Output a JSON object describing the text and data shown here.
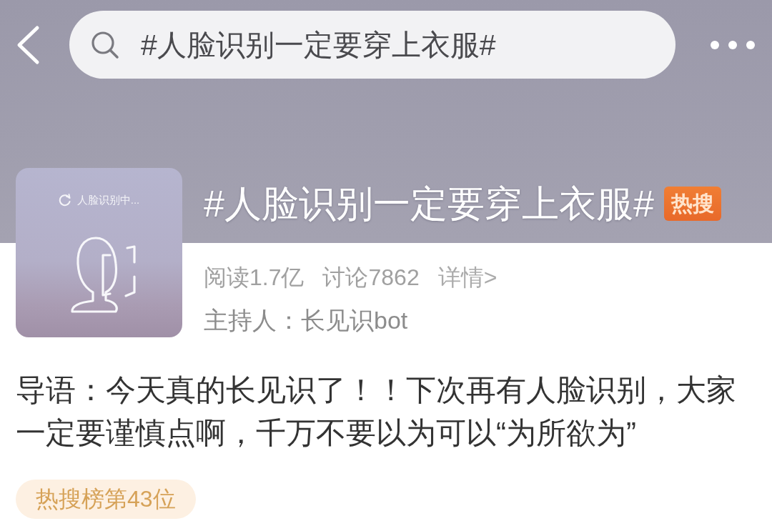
{
  "top_bar": {
    "search": {
      "value": "#人脸识别一定要穿上衣服#"
    }
  },
  "topic": {
    "thumbnail": {
      "caption": "人脸识别中..."
    },
    "title": "#人脸识别一定要穿上衣服#",
    "badge": "热搜",
    "stats": [
      {
        "kind": "count",
        "text": "阅读1.7亿"
      },
      {
        "kind": "count",
        "text": "讨论7862"
      },
      {
        "kind": "link",
        "text": "详情>"
      }
    ],
    "host": "主持人：长见识bot"
  },
  "intro": "导语：今天真的长见识了！！下次再有人脸识别，大家一定要谨慎点啊，千万不要以为可以“为所欲为”",
  "rank_badge": "热搜榜第43位"
}
